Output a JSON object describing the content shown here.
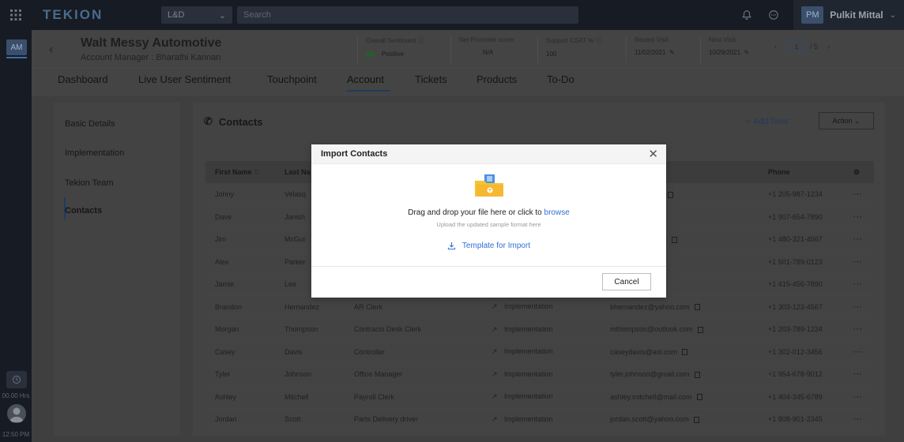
{
  "topbar": {
    "logo": "TEKION",
    "store": "L&D",
    "search_placeholder": "Search",
    "user_initials": "PM",
    "user_name": "Pulkit Mittal"
  },
  "rail": {
    "initials": "AM",
    "hours": "00.00 Hrs",
    "time": "12:50 PM"
  },
  "account": {
    "name": "Walt Messy Automotive",
    "manager": "Account Manager : Bharathi Kannan",
    "metrics": [
      {
        "label": "Overall Sentiment",
        "value": "Positive"
      },
      {
        "label": "Net Promoter score",
        "value": "N/A"
      },
      {
        "label": "Support CSAT %",
        "value": "100"
      },
      {
        "label": "Recent Visit",
        "value": "11/02/2021"
      },
      {
        "label": "Next Visit",
        "value": "10/29/2021"
      }
    ],
    "pager": {
      "current": "1",
      "total": "/ 5"
    }
  },
  "tabs": [
    "Dashboard",
    "Live User Sentiment",
    "Touchpoint",
    "Account",
    "Tickets",
    "Products",
    "To-Do"
  ],
  "active_tab": "Account",
  "side_nav": [
    "Basic Details",
    "Implementation",
    "Tekion Team",
    "Contacts"
  ],
  "contacts": {
    "title": "Contacts",
    "add_new": "+ Add New",
    "action": "Action",
    "columns": [
      "First Name",
      "Last Na",
      "",
      "",
      "",
      "Phone",
      ""
    ],
    "rows": [
      {
        "first": "Johny",
        "last": "Velasq",
        "role": "",
        "team": "",
        "email": "ez@bmwna.com",
        "phone": "+1 205-987-1234"
      },
      {
        "first": "Dave",
        "last": "Janish",
        "role": "",
        "team": "",
        "email": "@bmwna.com",
        "phone": "+1 907-654-7890"
      },
      {
        "first": "Jim",
        "last": "McGui",
        "role": "",
        "team": "",
        "email": "ess@bmwna.com",
        "phone": "+1 480-321-4567"
      },
      {
        "first": "Alex",
        "last": "Parker",
        "role": "",
        "team": "",
        "email": "com",
        "phone": "+1 501-789-0123"
      },
      {
        "first": "Jamie",
        "last": "Lee",
        "role": "",
        "team": "",
        "email": "",
        "phone": "+1 415-456-7890"
      },
      {
        "first": "Brandon",
        "last": "Hernandez",
        "role": "AR Clerk",
        "team": "Implementation",
        "email": "bhernandez@yahoo.com",
        "phone": "+1 303-123-4567"
      },
      {
        "first": "Morgan",
        "last": "Thompson",
        "role": "Contracts Desk Clerk",
        "team": "Implementation",
        "email": "mthompson@outlook.com",
        "phone": "+1 203-789-1234"
      },
      {
        "first": "Casey",
        "last": "Davis",
        "role": "Controller",
        "team": "Implementation",
        "email": "caseydavis@aol.com",
        "phone": "+1 302-012-3456"
      },
      {
        "first": "Tyler",
        "last": "Johnson",
        "role": "Office Manager",
        "team": "Implementation",
        "email": "tyler.johnson@gmail.com",
        "phone": "+1 954-678-9012"
      },
      {
        "first": "Ashley",
        "last": "Mitchell",
        "role": "Payroll Clerk",
        "team": "Implementation",
        "email": "ashley.mitchell@mail.com",
        "phone": "+1 404-345-6789"
      },
      {
        "first": "Jordan",
        "last": "Scott",
        "role": "Parts Delivery driver",
        "team": "Implementation",
        "email": "jordan.scott@yahoo.com",
        "phone": "+1 808-901-2345"
      }
    ]
  },
  "modal": {
    "title": "Import Contacts",
    "drop_text": "Drag and drop your file here or click to",
    "browse": "browse",
    "subtext": "Upload the updated sample format here",
    "template_link": "Template for Import",
    "cancel": "Cancel"
  },
  "colors": {
    "accent": "#2f6fd6",
    "folder": "#f4c430",
    "folder_tab": "#4a90e2"
  }
}
